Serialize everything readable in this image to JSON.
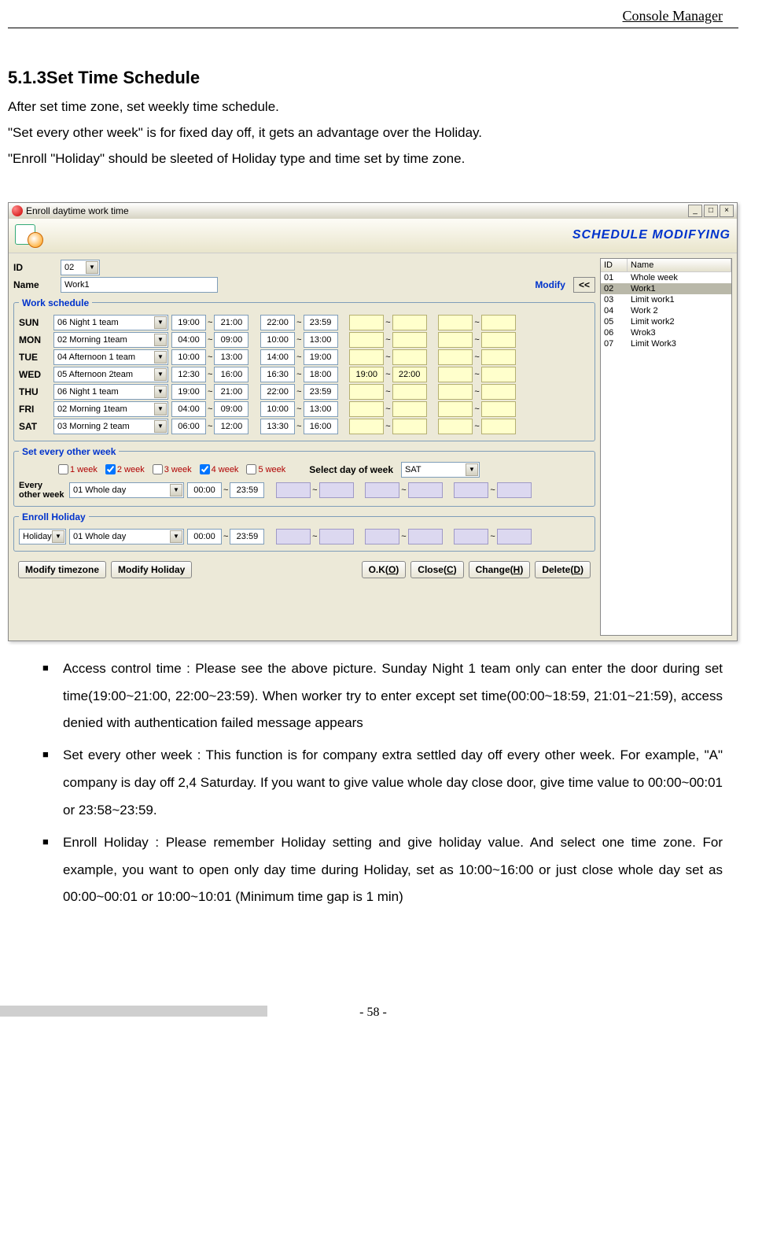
{
  "header": {
    "title": "Console Manager"
  },
  "section": {
    "heading": "5.1.3Set Time Schedule",
    "p1": "After set time zone, set weekly time schedule.",
    "p2": "\"Set every other week\" is for fixed day off, it gets an advantage over the Holiday.",
    "p3": "\"Enroll \"Holiday\" should be sleeted of Holiday type and time set by time zone."
  },
  "dialog": {
    "title": "Enroll daytime work time",
    "banner": "SCHEDULE MODIFYING",
    "id_label": "ID",
    "id_value": "02",
    "name_label": "Name",
    "name_value": "Work1",
    "modify_label": "Modify",
    "modify_btn": "<<",
    "fs_work": "Work schedule",
    "fs_every": "Set every other week",
    "fs_holiday": "Enroll Holiday",
    "days": [
      {
        "lbl": "SUN",
        "team": "06 Night 1 team",
        "t": [
          "19:00",
          "21:00",
          "22:00",
          "23:59",
          "",
          "",
          "",
          ""
        ]
      },
      {
        "lbl": "MON",
        "team": "02 Morning 1team",
        "t": [
          "04:00",
          "09:00",
          "10:00",
          "13:00",
          "",
          "",
          "",
          ""
        ]
      },
      {
        "lbl": "TUE",
        "team": "04 Afternoon 1 team",
        "t": [
          "10:00",
          "13:00",
          "14:00",
          "19:00",
          "",
          "",
          "",
          ""
        ]
      },
      {
        "lbl": "WED",
        "team": "05 Afternoon 2team",
        "t": [
          "12:30",
          "16:00",
          "16:30",
          "18:00",
          "19:00",
          "22:00",
          "",
          ""
        ]
      },
      {
        "lbl": "THU",
        "team": "06 Night 1 team",
        "t": [
          "19:00",
          "21:00",
          "22:00",
          "23:59",
          "",
          "",
          "",
          ""
        ]
      },
      {
        "lbl": "FRI",
        "team": "02 Morning 1team",
        "t": [
          "04:00",
          "09:00",
          "10:00",
          "13:00",
          "",
          "",
          "",
          ""
        ]
      },
      {
        "lbl": "SAT",
        "team": "03 Morning 2 team",
        "t": [
          "06:00",
          "12:00",
          "13:30",
          "16:00",
          "",
          "",
          "",
          ""
        ]
      }
    ],
    "weeks": [
      {
        "label": "1 week",
        "checked": false
      },
      {
        "label": "2 week",
        "checked": true
      },
      {
        "label": "3 week",
        "checked": false
      },
      {
        "label": "4 week",
        "checked": true
      },
      {
        "label": "5 week",
        "checked": false
      }
    ],
    "select_day_label": "Select day of week",
    "select_day_value": "SAT",
    "every_row": {
      "lbl": "Every other week",
      "team": "01 Whole day",
      "t": [
        "00:00",
        "23:59",
        "",
        "",
        "",
        "",
        "",
        ""
      ]
    },
    "holiday_row": {
      "type": "Holiday",
      "team": "01 Whole day",
      "t": [
        "00:00",
        "23:59",
        "",
        "",
        "",
        "",
        "",
        ""
      ]
    },
    "footer": {
      "modify_tz": "Modify timezone",
      "modify_h": "Modify Holiday",
      "ok": "O.K(O)",
      "close": "Close(C)",
      "change": "Change(H)",
      "delete": "Delete(D)"
    },
    "list": {
      "col_id": "ID",
      "col_name": "Name",
      "rows": [
        {
          "id": "01",
          "name": "Whole week"
        },
        {
          "id": "02",
          "name": "Work1",
          "sel": true
        },
        {
          "id": "03",
          "name": "Limit work1"
        },
        {
          "id": "04",
          "name": "Work 2"
        },
        {
          "id": "05",
          "name": "Limit work2"
        },
        {
          "id": "06",
          "name": "Wrok3"
        },
        {
          "id": "07",
          "name": "Limit Work3"
        }
      ]
    }
  },
  "notes": {
    "n1": "Access control time : Please see the above picture. Sunday Night 1 team only can enter the door during set time(19:00~21:00, 22:00~23:59). When worker try to enter except set time(00:00~18:59, 21:01~21:59), access denied with authentication failed message appears",
    "n2": "Set every other week : This function is for company extra settled day off every other week. For example, \"A\" company is day off 2,4 Saturday. If you want to give value whole day close door, give time value to 00:00~00:01 or 23:58~23:59.",
    "n3": "Enroll Holiday : Please remember Holiday setting and give holiday value. And select one time zone. For example, you want to open only day time during Holiday, set as 10:00~16:00 or just close whole day set as 00:00~00:01 or 10:00~10:01 (Minimum time gap is 1 min)"
  },
  "page_number": "- 58 -"
}
